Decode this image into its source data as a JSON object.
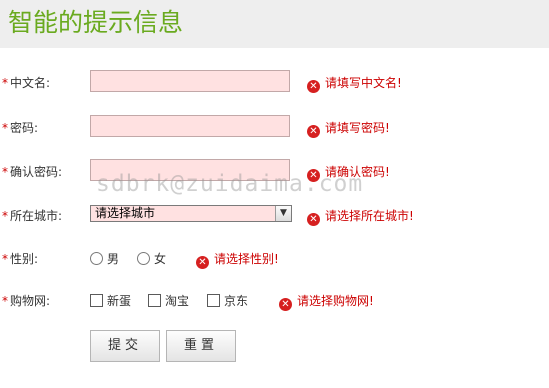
{
  "header": {
    "title": "智能的提示信息"
  },
  "required_mark": "*",
  "form": {
    "chinese_name": {
      "label": "中文名:",
      "value": "",
      "error": "请填写中文名!"
    },
    "password": {
      "label": "密码:",
      "value": "",
      "error": "请填写密码!"
    },
    "confirm_password": {
      "label": "确认密码:",
      "value": "",
      "error": "请确认密码!"
    },
    "city": {
      "label": "所在城市:",
      "selected": "请选择城市",
      "error": "请选择所在城市!"
    },
    "gender": {
      "label": "性别:",
      "options": [
        "男",
        "女"
      ],
      "error": "请选择性别!"
    },
    "shopping": {
      "label": "购物网:",
      "options": [
        "新蛋",
        "淘宝",
        "京东"
      ],
      "error": "请选择购物网!"
    }
  },
  "buttons": {
    "submit": "提交",
    "reset": "重置"
  },
  "watermark": "sdbrk@zuidaima.com",
  "icons": {
    "error": "error-circle-icon",
    "dropdown": "chevron-down-icon"
  },
  "colors": {
    "title": "#6aaa1f",
    "error": "#cc0000",
    "field_bg": "#ffe1e1"
  }
}
